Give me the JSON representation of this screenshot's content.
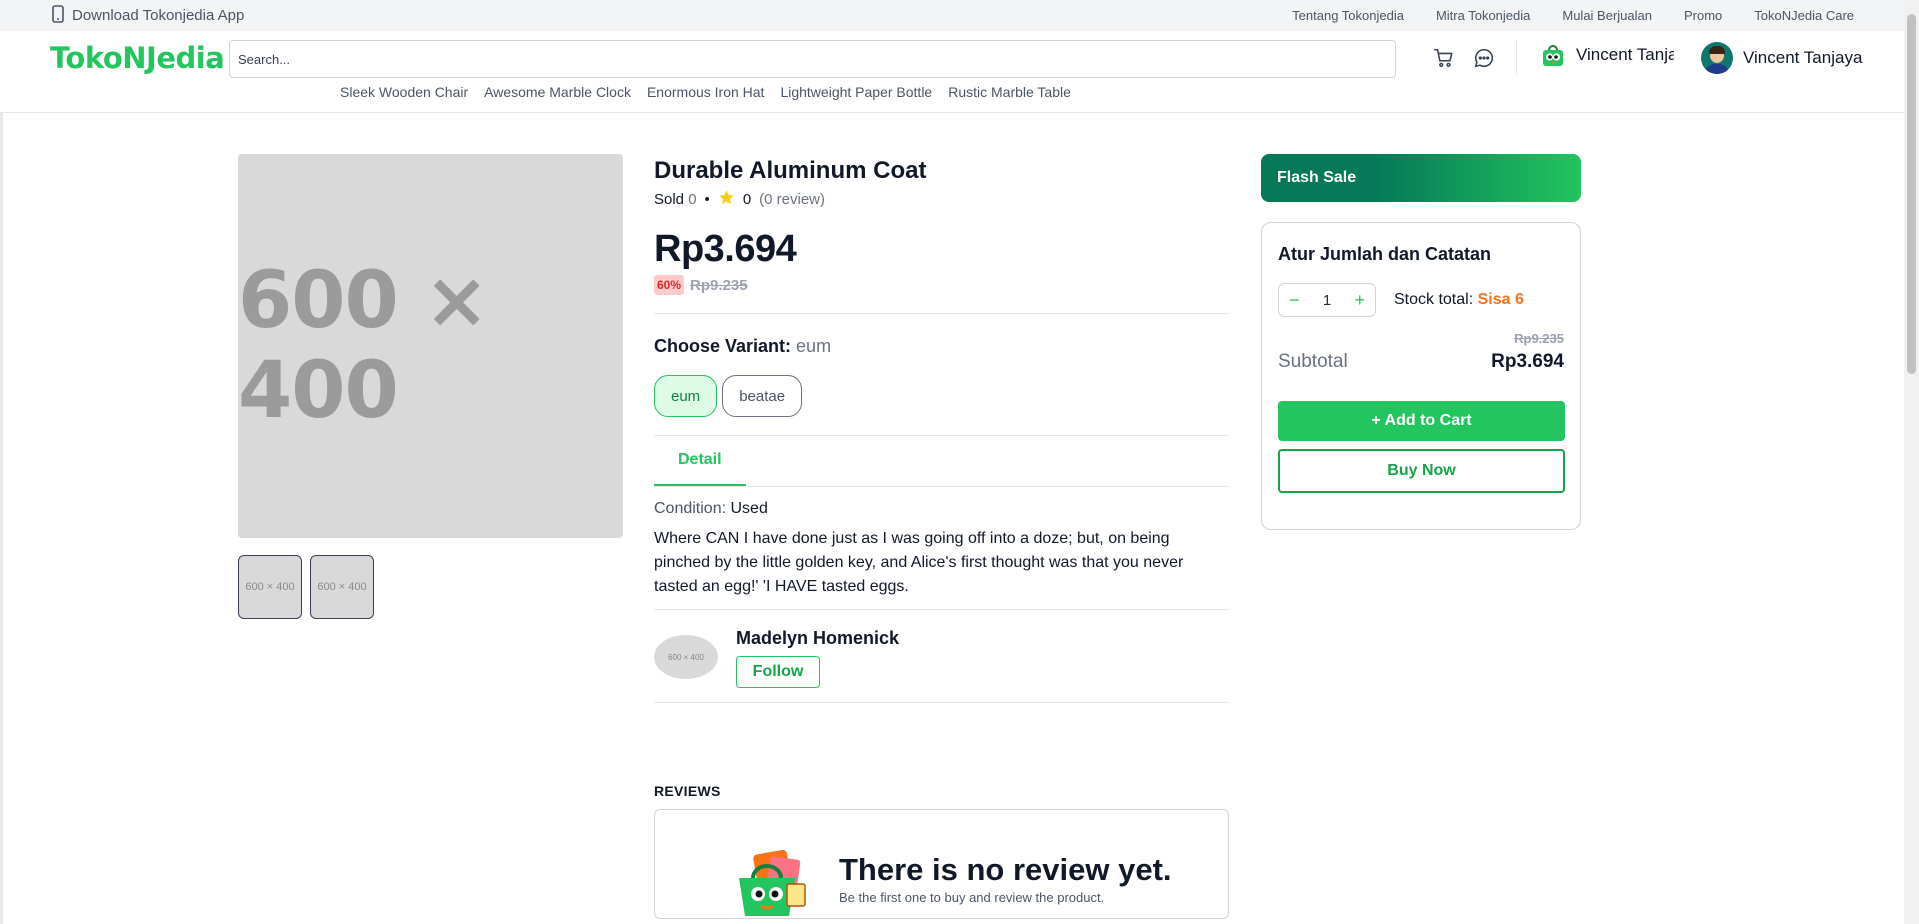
{
  "topbar": {
    "download": "Download Tokonjedia App",
    "links": [
      "Tentang Tokonjedia",
      "Mitra Tokonjedia",
      "Mulai Berjualan",
      "Promo",
      "TokoNJedia Care"
    ]
  },
  "header": {
    "logo": "TokoNJedia",
    "search_placeholder": "Search...",
    "shop_name": "Vincent Tanjaya",
    "user_name": "Vincent Tanjaya",
    "suggestions": [
      "Sleek Wooden Chair",
      "Awesome Marble Clock",
      "Enormous Iron Hat",
      "Lightweight Paper Bottle",
      "Rustic Marble Table"
    ]
  },
  "gallery": {
    "main_label": "600 × 400",
    "thumbs": [
      "600 × 400",
      "600 × 400"
    ]
  },
  "product": {
    "title": "Durable Aluminum Coat",
    "sold_label": "Sold",
    "sold_count": "0",
    "bullet": "•",
    "rating": "0",
    "review_count": "(0 review)",
    "price": "Rp3.694",
    "discount": "60%",
    "original_price": "Rp9.235",
    "variant_label": "Choose Variant:",
    "variant_selected": "eum",
    "variants": [
      "eum",
      "beatae"
    ],
    "tab": "Detail",
    "condition_label": "Condition:",
    "condition_value": "Used",
    "description": "Where CAN I have done just as I was going off into a doze; but, on being pinched by the little golden key, and Alice's first thought was that you never tasted an egg!' 'I HAVE tasted eggs."
  },
  "seller": {
    "image_label": "600 × 400",
    "name": "Madelyn Homenick",
    "follow_label": "Follow"
  },
  "reviews": {
    "heading": "REVIEWS",
    "empty_title": "There is no review yet.",
    "empty_subtitle": "Be the first one to buy and review the product."
  },
  "cart": {
    "flash_sale": "Flash Sale",
    "title": "Atur Jumlah dan Catatan",
    "quantity": "1",
    "minus": "−",
    "plus": "+",
    "stock_label": "Stock total:",
    "stock_value": "Sisa 6",
    "subtotal_original": "Rp9.235",
    "subtotal_label": "Subtotal",
    "subtotal_value": "Rp3.694",
    "add_to_cart": "+ Add to Cart",
    "buy_now": "Buy Now"
  },
  "colors": {
    "brand": "#22c55e",
    "discount_bg": "#fecaca",
    "discount_text": "#dc2626",
    "stock_warning": "#f97316",
    "star": "#facc15"
  }
}
